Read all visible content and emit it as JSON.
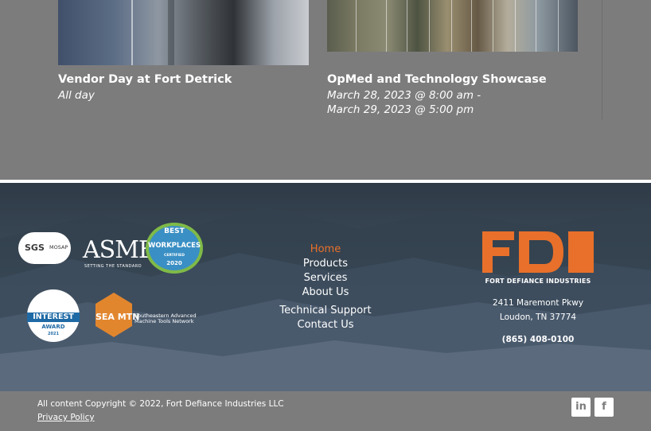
{
  "events": [
    {
      "title": "Vendor Day at Fort Detrick",
      "date": "All day"
    },
    {
      "title": "OpMed and Technology Showcase",
      "date_start": "March 28, 2023 @ 8:00 am -",
      "date_end": "March 29, 2023 @ 5:00 pm"
    }
  ],
  "badges": {
    "sgs": {
      "main": "SGS",
      "sub": "MOSAP"
    },
    "asme": {
      "main": "ASME",
      "sub": "SETTING THE STANDARD"
    },
    "best_workplaces": {
      "line1": "BEST",
      "line2": "WORKPLACES",
      "line3": "CERTIFIED",
      "year": "2020"
    },
    "interest_award": {
      "line1": "INTEREST",
      "line2": "AWARD",
      "year": "2021"
    },
    "seamtn": {
      "main": "SEA MTN",
      "line1": "Southeastern Advanced",
      "line2": "Machine Tools Network"
    }
  },
  "menu": {
    "home": "Home",
    "products": "Products",
    "services": "Services",
    "about": "About Us",
    "support": "Technical Support",
    "contact": "Contact Us"
  },
  "company": {
    "logo": "FDI",
    "name": "FORT DEFIANCE INDUSTRIES",
    "address_line1": "2411 Maremont Pkwy",
    "address_line2": "Loudon, TN 37774",
    "phone": "(865) 408-0100"
  },
  "footer_bottom": {
    "copyright": "All content Copyright © 2022, Fort Defiance Industries LLC",
    "privacy": "Privacy Policy",
    "linkedin": "in",
    "facebook": "f"
  },
  "colors": {
    "accent": "#e8702a",
    "gray": "#7d7c7d",
    "footer": "#3a4856"
  },
  "icons": [
    "linkedin-icon",
    "facebook-icon",
    "fdi-logo-icon",
    "seamtn-hex-icon"
  ]
}
